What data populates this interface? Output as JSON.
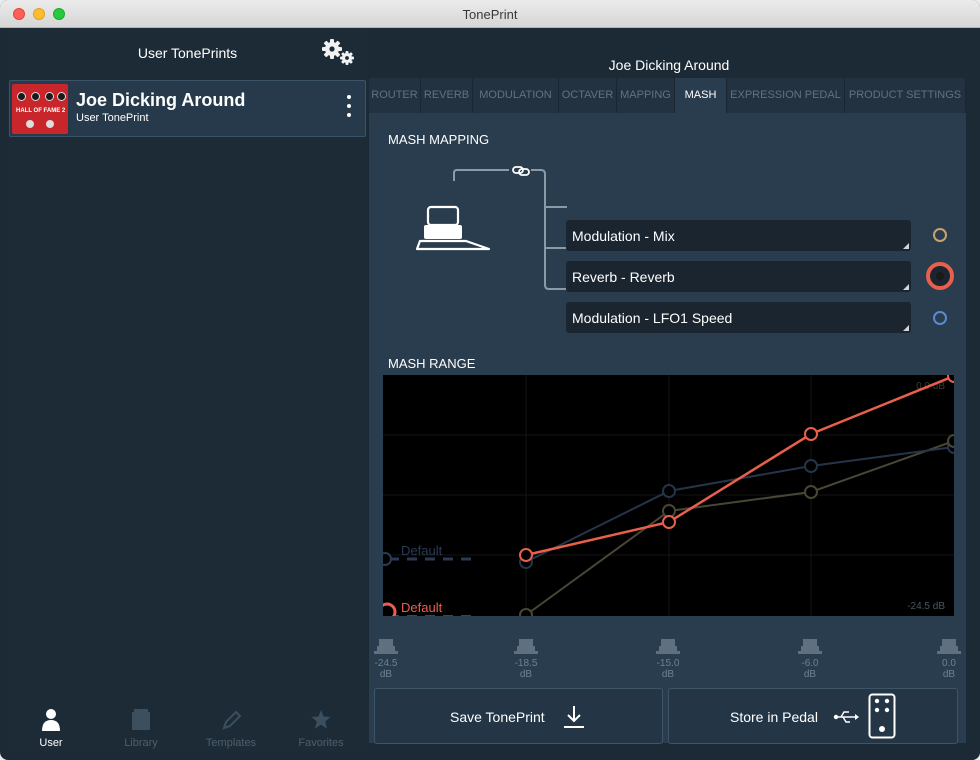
{
  "window": {
    "title": "TonePrint"
  },
  "sidebar": {
    "header": "User TonePrints",
    "toneprint": {
      "name": "Joe Dicking Around",
      "subtitle": "User TonePrint",
      "thumb_text": "HALL OF FAME 2"
    },
    "nav": [
      {
        "label": "User",
        "icon": "user-icon",
        "active": true
      },
      {
        "label": "Library",
        "icon": "library-icon",
        "active": false
      },
      {
        "label": "Templates",
        "icon": "pencil-icon",
        "active": false
      },
      {
        "label": "Favorites",
        "icon": "star-icon",
        "active": false
      }
    ]
  },
  "main": {
    "preset_title": "Joe Dicking Around",
    "tabs": [
      {
        "label": "ROUTER",
        "active": false
      },
      {
        "label": "REVERB",
        "active": false
      },
      {
        "label": "MODULATION",
        "active": false
      },
      {
        "label": "OCTAVER",
        "active": false
      },
      {
        "label": "MAPPING",
        "active": false
      },
      {
        "label": "MASH",
        "active": true
      },
      {
        "label": "EXPRESSION PEDAL",
        "active": false
      },
      {
        "label": "PRODUCT SETTINGS",
        "active": false
      }
    ],
    "mash_mapping": {
      "label": "MASH MAPPING",
      "link_icon": "link-icon",
      "rows": [
        {
          "label": "Modulation - Mix",
          "color": "#c9a36a",
          "selected": false
        },
        {
          "label": "Reverb - Reverb",
          "color": "#e8604c",
          "selected": true
        },
        {
          "label": "Modulation - LFO1 Speed",
          "color": "#5a8ad0",
          "selected": false
        }
      ]
    },
    "mash_range": {
      "label": "MASH RANGE",
      "top_value": "0.0 dB",
      "bottom_value": "-24.5 dB",
      "default_labels": [
        "Default",
        "Default"
      ]
    },
    "faders": [
      {
        "value": "-24.5",
        "unit": "dB"
      },
      {
        "value": "-18.5",
        "unit": "dB"
      },
      {
        "value": "-15.0",
        "unit": "dB"
      },
      {
        "value": "-6.0",
        "unit": "dB"
      },
      {
        "value": "0.0",
        "unit": "dB"
      }
    ],
    "buttons": {
      "save": "Save TonePrint",
      "store": "Store in Pedal"
    }
  },
  "colors": {
    "accent_red": "#e8604c",
    "gold": "#c9a36a",
    "blue": "#5a8ad0"
  }
}
